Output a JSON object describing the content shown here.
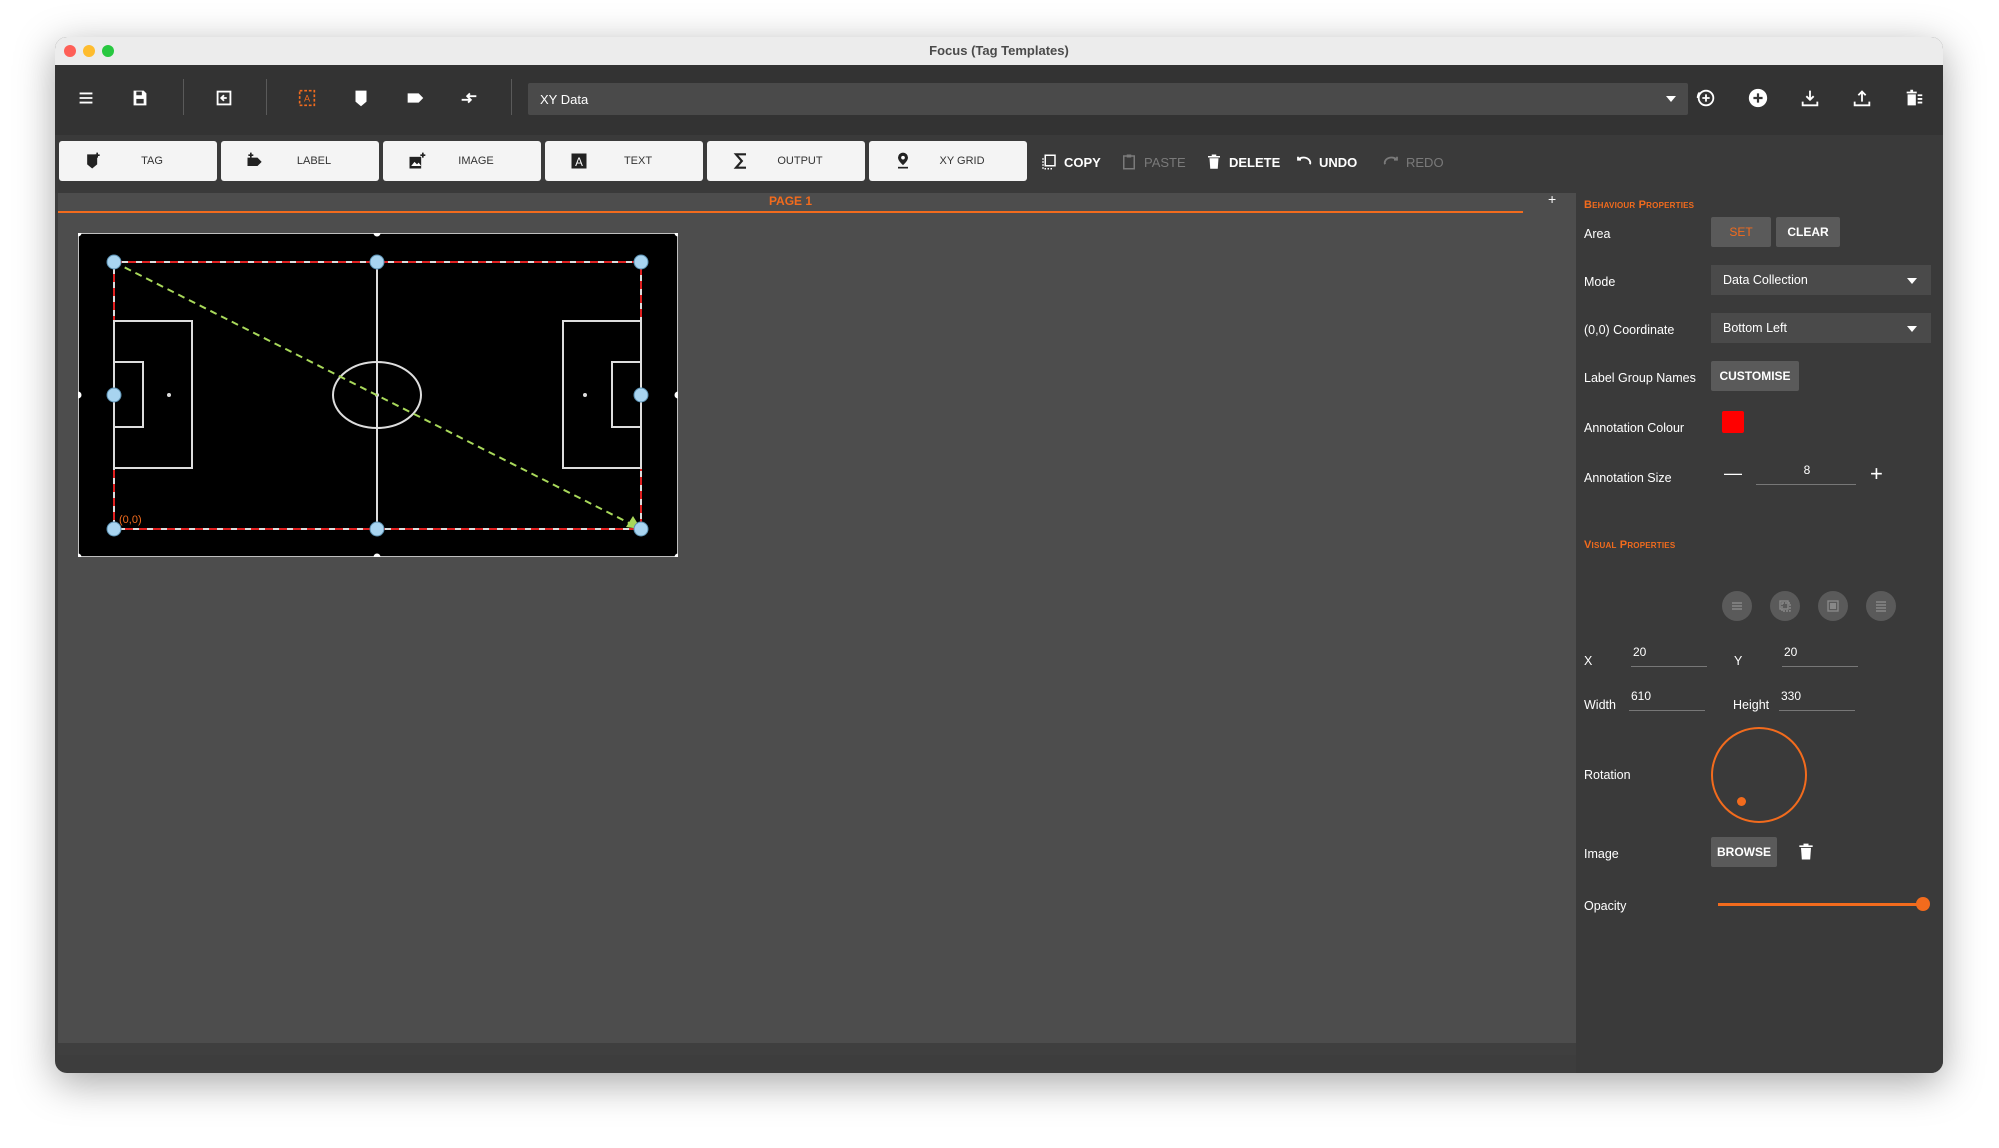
{
  "window": {
    "title": "Focus (Tag Templates)"
  },
  "toolbar": {
    "template_select": "XY Data",
    "icons": [
      "menu-icon",
      "save-icon",
      "exit-icon",
      "select-area-icon",
      "tag-icon",
      "label-icon",
      "swap-icon",
      "target-icon",
      "add-circle-icon",
      "download-icon",
      "upload-icon",
      "delete-list-icon"
    ]
  },
  "tools": [
    {
      "label": "TAG",
      "icon": "tag-plus-icon"
    },
    {
      "label": "LABEL",
      "icon": "label-plus-icon"
    },
    {
      "label": "IMAGE",
      "icon": "image-plus-icon"
    },
    {
      "label": "TEXT",
      "icon": "text-icon"
    },
    {
      "label": "OUTPUT",
      "icon": "sigma-icon"
    },
    {
      "label": "XY GRID",
      "icon": "location-pin-icon"
    }
  ],
  "actions": {
    "copy": "COPY",
    "paste": "PASTE",
    "delete": "DELETE",
    "undo": "UNDO",
    "redo": "REDO"
  },
  "canvas": {
    "page_tab": "PAGE 1",
    "add_page": "+",
    "origin_label": "(0,0)"
  },
  "properties": {
    "behaviour_title": "Behaviour Properties",
    "area_label": "Area",
    "set_button": "SET",
    "clear_button": "CLEAR",
    "mode_label": "Mode",
    "mode_value": "Data Collection",
    "coord_label": "(0,0) Coordinate",
    "coord_value": "Bottom Left",
    "label_group_label": "Label Group Names",
    "customise_button": "CUSTOMISE",
    "annotation_colour_label": "Annotation Colour",
    "annotation_colour": "#ff0000",
    "annotation_size_label": "Annotation Size",
    "annotation_size_value": "8",
    "minus": "—",
    "plus": "+",
    "visual_title": "Visual Properties",
    "x_label": "X",
    "x_value": "20",
    "y_label": "Y",
    "y_value": "20",
    "width_label": "Width",
    "width_value": "610",
    "height_label": "Height",
    "height_value": "330",
    "rotation_label": "Rotation",
    "image_label": "Image",
    "browse_button": "BROWSE",
    "opacity_label": "Opacity",
    "opacity_value": 1.0
  },
  "colors": {
    "accent": "#f26b1d",
    "bg_dark": "#333333",
    "canvas": "#4d4d4d"
  }
}
